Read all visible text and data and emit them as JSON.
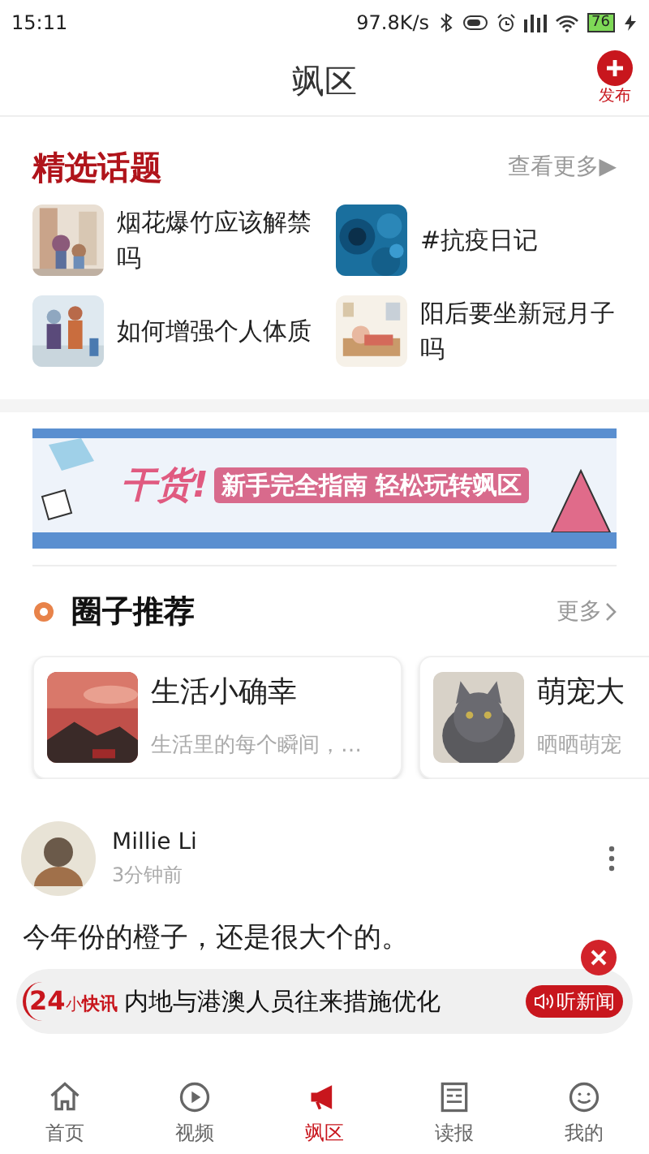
{
  "status_bar": {
    "time": "15:11",
    "speed": "97.8K/s",
    "battery": "76"
  },
  "header": {
    "title": "飒区",
    "publish": "发布"
  },
  "topics": {
    "title": "精选话题",
    "more": "查看更多▶",
    "items": [
      {
        "text": "烟花爆竹应该解禁吗"
      },
      {
        "text": "#抗疫日记"
      },
      {
        "text": "如何增强个人体质"
      },
      {
        "text": "阳后要坐新冠月子吗"
      }
    ]
  },
  "banner": {
    "badge": "干货!",
    "text": "新手完全指南 轻松玩转飒区"
  },
  "circles": {
    "title": "圈子推荐",
    "more": "更多",
    "items": [
      {
        "name": "生活小确幸",
        "desc": "生活里的每个瞬间，…"
      },
      {
        "name": "萌宠大",
        "desc": "晒晒萌宠"
      }
    ]
  },
  "post": {
    "author": "Millie Li",
    "time": "3分钟前",
    "text": "今年份的橙子，还是很大个的。"
  },
  "news_bar": {
    "logo_number": "24",
    "logo_mark": "小",
    "logo_text": "快讯",
    "headline": "内地与港澳人员往来措施优化",
    "listen": "听新闻"
  },
  "tabs": [
    {
      "label": "首页",
      "selected": false
    },
    {
      "label": "视频",
      "selected": false
    },
    {
      "label": "飒区",
      "selected": true
    },
    {
      "label": "读报",
      "selected": false
    },
    {
      "label": "我的",
      "selected": false
    }
  ]
}
